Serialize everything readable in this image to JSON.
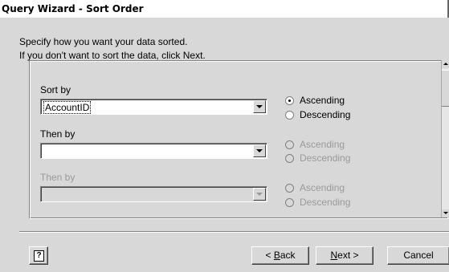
{
  "window": {
    "title": "Query Wizard - Sort Order"
  },
  "instructions": {
    "line1": "Specify how you want your data sorted.",
    "line2": "If you don't want to sort the data, click Next."
  },
  "sort_rows": [
    {
      "label": "Sort by",
      "value": "AccountID",
      "enabled": true,
      "ascending_label": "Ascending",
      "descending_label": "Descending",
      "selected": "Ascending"
    },
    {
      "label": "Then by",
      "value": "",
      "enabled": true,
      "ascending_label": "Ascending",
      "descending_label": "Descending",
      "selected": null
    },
    {
      "label": "Then by",
      "value": "",
      "enabled": false,
      "ascending_label": "Ascending",
      "descending_label": "Descending",
      "selected": null
    }
  ],
  "buttons": {
    "help_glyph": "?",
    "back_prefix": "< ",
    "back_hotkey": "B",
    "back_rest": "ack",
    "next_hotkey": "N",
    "next_rest": "ext >",
    "cancel": "Cancel"
  },
  "icons": {
    "dropdown": "chevron-down-icon",
    "help": "help-icon",
    "scroll_up": "scroll-up-icon",
    "scroll_down": "scroll-down-icon"
  },
  "colors": {
    "dialog_bg": "#d8d8d8",
    "titlebar_bg": "#ffffff",
    "disabled_text": "#9a9a9a"
  }
}
